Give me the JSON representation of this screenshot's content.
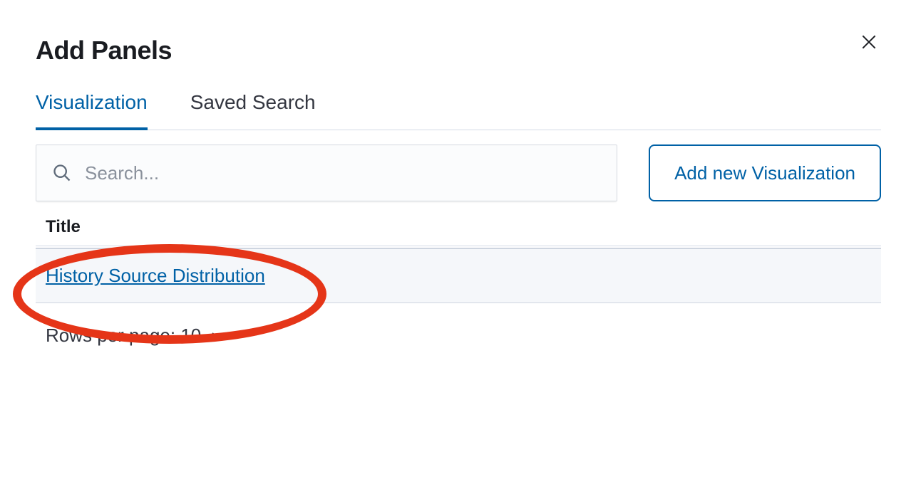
{
  "header": {
    "title": "Add Panels"
  },
  "tabs": [
    {
      "label": "Visualization",
      "active": true
    },
    {
      "label": "Saved Search",
      "active": false
    }
  ],
  "search": {
    "placeholder": "Search..."
  },
  "actions": {
    "addNew": "Add new Visualization"
  },
  "table": {
    "columns": [
      {
        "label": "Title"
      }
    ],
    "rows": [
      {
        "title": "History Source Distribution"
      }
    ]
  },
  "pagination": {
    "rowsPerPageLabel": "Rows per page: 10"
  }
}
